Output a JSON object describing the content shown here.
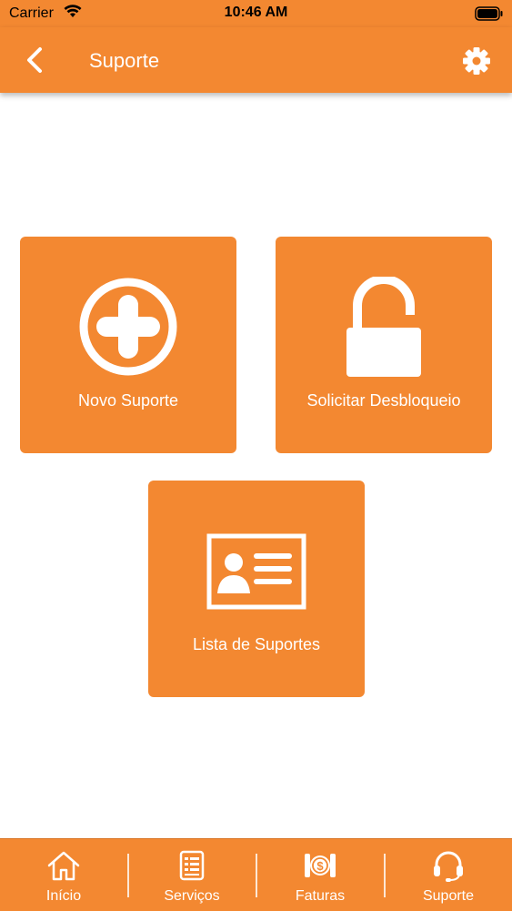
{
  "status_bar": {
    "carrier": "Carrier",
    "time": "10:46 AM"
  },
  "header": {
    "title": "Suporte",
    "back_icon": "chevron-left-icon",
    "settings_icon": "gear-icon"
  },
  "tiles": [
    {
      "label": "Novo Suporte",
      "icon": "plus-circle-icon"
    },
    {
      "label": "Solicitar Desbloqueio",
      "icon": "unlock-icon"
    },
    {
      "label": "Lista de Suportes",
      "icon": "id-card-icon"
    }
  ],
  "tab_bar": {
    "items": [
      {
        "label": "Início",
        "icon": "home-icon"
      },
      {
        "label": "Serviços",
        "icon": "document-list-icon"
      },
      {
        "label": "Faturas",
        "icon": "coins-icon"
      },
      {
        "label": "Suporte",
        "icon": "headset-icon"
      }
    ]
  },
  "colors": {
    "primary": "#f38831",
    "text_on_primary": "#ffffff",
    "background": "#ffffff"
  }
}
